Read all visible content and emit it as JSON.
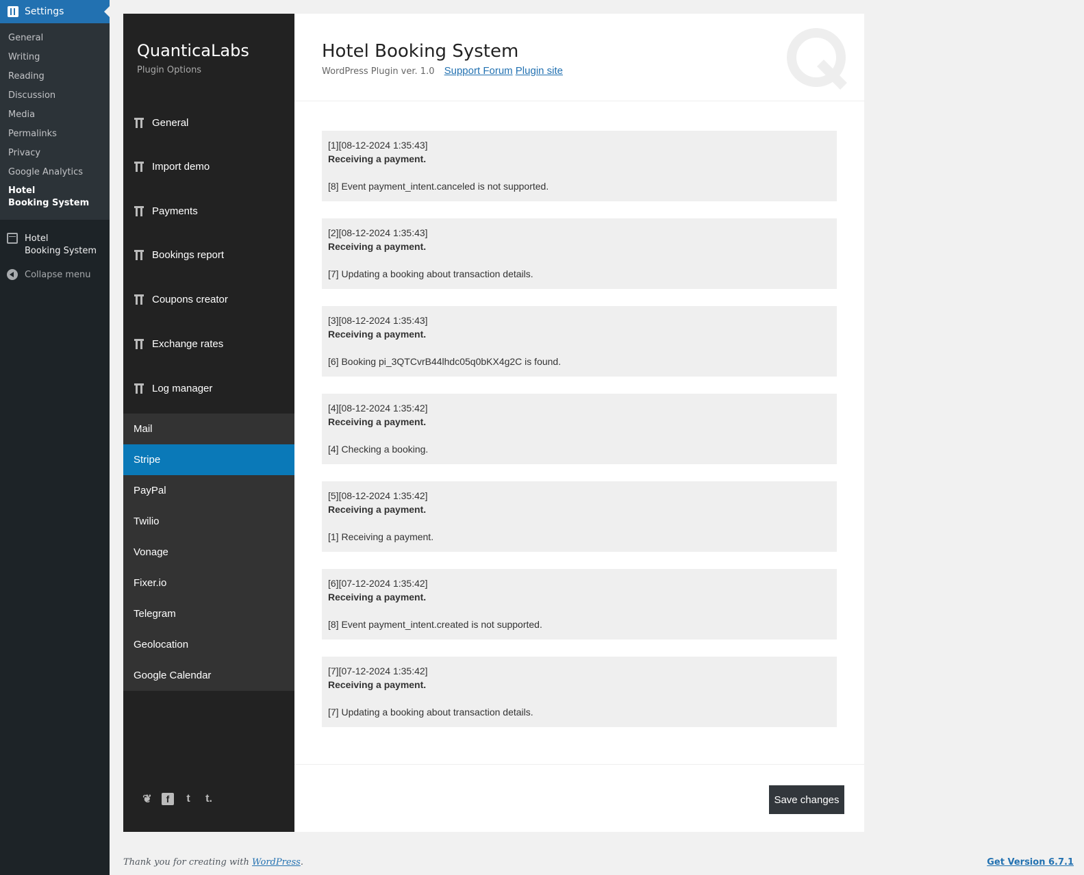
{
  "wp_menu": {
    "settings_label": "Settings",
    "submenu": [
      "General",
      "Writing",
      "Reading",
      "Discussion",
      "Media",
      "Permalinks",
      "Privacy",
      "Google Analytics"
    ],
    "current_line1": "Hotel",
    "current_line2": "Booking System",
    "hbs_line1": "Hotel",
    "hbs_line2": "Booking System",
    "collapse_label": "Collapse menu"
  },
  "plugin": {
    "brand": "QuanticaLabs",
    "brand_sub": "Plugin Options",
    "nav": [
      "General",
      "Import demo",
      "Payments",
      "Bookings report",
      "Coupons creator",
      "Exchange rates",
      "Log manager"
    ],
    "log_submenu": [
      "Mail",
      "Stripe",
      "PayPal",
      "Twilio",
      "Vonage",
      "Fixer.io",
      "Telegram",
      "Geolocation",
      "Google Calendar"
    ],
    "active_submenu": "Stripe"
  },
  "header": {
    "title": "Hotel Booking System",
    "version": "WordPress Plugin ver. 1.0",
    "support_link": "Support Forum",
    "site_link": "Plugin site"
  },
  "logs": [
    {
      "header": "[1][08-12-2024 1:35:43]",
      "title": "Receiving a payment.",
      "message": "[8] Event payment_intent.canceled is not supported."
    },
    {
      "header": "[2][08-12-2024 1:35:43]",
      "title": "Receiving a payment.",
      "message": "[7] Updating a booking about transaction details."
    },
    {
      "header": "[3][08-12-2024 1:35:43]",
      "title": "Receiving a payment.",
      "message": "[6] Booking pi_3QTCvrB44lhdc05q0bKX4g2C is found."
    },
    {
      "header": "[4][08-12-2024 1:35:42]",
      "title": "Receiving a payment.",
      "message": "[4] Checking a booking."
    },
    {
      "header": "[5][08-12-2024 1:35:42]",
      "title": "Receiving a payment.",
      "message": "[1] Receiving a payment."
    },
    {
      "header": "[6][07-12-2024 1:35:42]",
      "title": "Receiving a payment.",
      "message": "[8] Event payment_intent.created is not supported."
    },
    {
      "header": "[7][07-12-2024 1:35:42]",
      "title": "Receiving a payment.",
      "message": "[7] Updating a booking about transaction details."
    }
  ],
  "save_label": "Save changes",
  "footer": {
    "thanks": "Thank you for creating with",
    "wp_link": "WordPress",
    "version": "Get Version 6.7.1"
  },
  "colors": {
    "wp_sidebar": "#1d2327",
    "wp_accent": "#2271b1",
    "plugin_nav": "#222222",
    "plugin_active": "#0a79b8"
  }
}
